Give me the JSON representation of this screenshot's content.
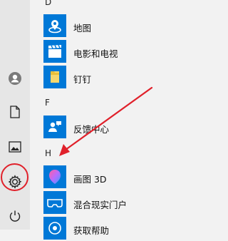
{
  "sections": {
    "d": "D",
    "f": "F",
    "h": "H"
  },
  "apps": {
    "maps": "地图",
    "movies": "电影和电视",
    "dingtalk": "钉钉",
    "feedback": "反馈中心",
    "paint3d": "画图 3D",
    "mixed_reality": "混合现实门户",
    "get_help": "获取帮助"
  },
  "icons": {
    "user": "user-icon",
    "documents": "document-icon",
    "pictures": "picture-icon",
    "settings": "gear-icon",
    "power": "power-icon"
  },
  "colors": {
    "tile_blue": "#0078d7",
    "annotation_red": "#e0202a"
  }
}
